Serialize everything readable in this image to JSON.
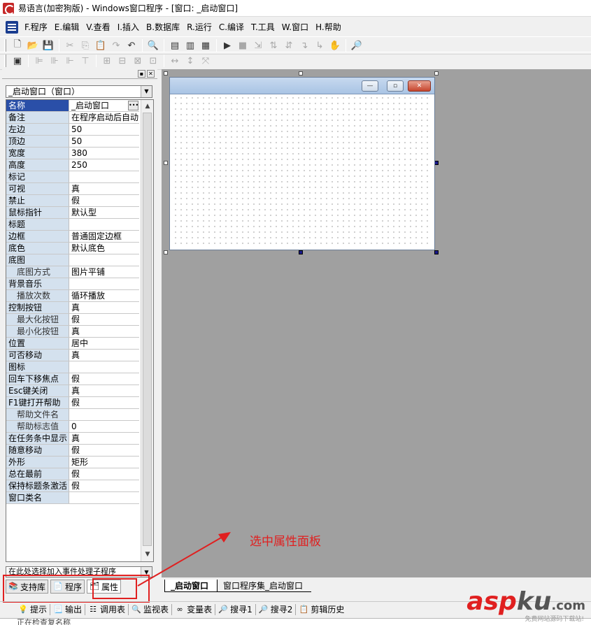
{
  "window": {
    "title": "易语言(加密狗版) - Windows窗口程序 - [窗口: _启动窗口]"
  },
  "menu": [
    "F.程序",
    "E.编辑",
    "V.查看",
    "I.插入",
    "B.数据库",
    "R.运行",
    "C.编译",
    "T.工具",
    "W.窗口",
    "H.帮助"
  ],
  "toolbar1": [
    {
      "icon": "new-file-icon",
      "glyph": "🗋"
    },
    {
      "icon": "open-folder-icon",
      "glyph": "📂"
    },
    {
      "icon": "save-icon",
      "glyph": "💾"
    },
    {
      "sep": true
    },
    {
      "icon": "cut-icon",
      "glyph": "✂",
      "dim": true
    },
    {
      "icon": "copy-icon",
      "glyph": "⎘",
      "dim": true
    },
    {
      "icon": "paste-icon",
      "glyph": "📋"
    },
    {
      "icon": "redo-icon",
      "glyph": "↷",
      "dim": true
    },
    {
      "icon": "undo-icon",
      "glyph": "↶"
    },
    {
      "sep": true
    },
    {
      "icon": "find-icon",
      "glyph": "🔍"
    },
    {
      "sep": true
    },
    {
      "icon": "layout-1-icon",
      "glyph": "▤"
    },
    {
      "icon": "layout-2-icon",
      "glyph": "▥"
    },
    {
      "icon": "layout-3-icon",
      "glyph": "▦"
    },
    {
      "sep": true
    },
    {
      "icon": "run-icon",
      "glyph": "▶"
    },
    {
      "icon": "stop-icon",
      "glyph": "■",
      "dim": true
    },
    {
      "icon": "step-1-icon",
      "glyph": "⇲",
      "dim": true
    },
    {
      "icon": "step-2-icon",
      "glyph": "⇅",
      "dim": true
    },
    {
      "icon": "step-3-icon",
      "glyph": "⇵",
      "dim": true
    },
    {
      "icon": "step-4-icon",
      "glyph": "↴",
      "dim": true
    },
    {
      "icon": "step-5-icon",
      "glyph": "↳",
      "dim": true
    },
    {
      "icon": "hand-icon",
      "glyph": "✋",
      "dim": true
    },
    {
      "sep": true
    },
    {
      "icon": "help-search-icon",
      "glyph": "🔎"
    }
  ],
  "toolbar2": [
    {
      "icon": "form-icon",
      "glyph": "▣"
    },
    {
      "sep": true
    },
    {
      "icon": "align-left-icon",
      "glyph": "⊫",
      "dim": true
    },
    {
      "icon": "align-center-icon",
      "glyph": "⊪",
      "dim": true
    },
    {
      "icon": "align-right-icon",
      "glyph": "⊩",
      "dim": true
    },
    {
      "icon": "align-top-icon",
      "glyph": "⊤",
      "dim": true
    },
    {
      "sep": true
    },
    {
      "icon": "center-h-icon",
      "glyph": "⊞",
      "dim": true
    },
    {
      "icon": "center-v-icon",
      "glyph": "⊟",
      "dim": true
    },
    {
      "icon": "space-h-icon",
      "glyph": "⊠",
      "dim": true
    },
    {
      "icon": "space-v-icon",
      "glyph": "⊡",
      "dim": true
    },
    {
      "sep": true
    },
    {
      "icon": "size-w-icon",
      "glyph": "↔",
      "dim": true
    },
    {
      "icon": "size-h-icon",
      "glyph": "↕",
      "dim": true
    },
    {
      "icon": "size-both-icon",
      "glyph": "⤧",
      "dim": true
    }
  ],
  "object_selector": "_启动窗口（窗口）",
  "properties": [
    {
      "name": "名称",
      "value": "_启动窗口",
      "selected": true,
      "ellipsis": true
    },
    {
      "name": "备注",
      "value": "在程序启动后自动"
    },
    {
      "name": "左边",
      "value": "50"
    },
    {
      "name": "顶边",
      "value": "50"
    },
    {
      "name": "宽度",
      "value": "380"
    },
    {
      "name": "高度",
      "value": "250"
    },
    {
      "name": "标记",
      "value": ""
    },
    {
      "name": "可视",
      "value": "真"
    },
    {
      "name": "禁止",
      "value": "假"
    },
    {
      "name": "鼠标指针",
      "value": "默认型"
    },
    {
      "name": "标题",
      "value": ""
    },
    {
      "name": "边框",
      "value": "普通固定边框"
    },
    {
      "name": "底色",
      "value": "默认底色"
    },
    {
      "name": "底图",
      "value": ""
    },
    {
      "name": "底图方式",
      "value": "图片平铺",
      "sub": true
    },
    {
      "name": "背景音乐",
      "value": ""
    },
    {
      "name": "播放次数",
      "value": "循环播放",
      "sub": true
    },
    {
      "name": "控制按钮",
      "value": "真"
    },
    {
      "name": "最大化按钮",
      "value": "假",
      "sub": true
    },
    {
      "name": "最小化按钮",
      "value": "真",
      "sub": true
    },
    {
      "name": "位置",
      "value": "居中"
    },
    {
      "name": "可否移动",
      "value": "真"
    },
    {
      "name": "图标",
      "value": ""
    },
    {
      "name": "回车下移焦点",
      "value": "假"
    },
    {
      "name": "Esc键关闭",
      "value": "真"
    },
    {
      "name": "F1键打开帮助",
      "value": "假"
    },
    {
      "name": "帮助文件名",
      "value": "",
      "sub": true
    },
    {
      "name": "帮助标志值",
      "value": "0",
      "sub": true
    },
    {
      "name": "在任务条中显示",
      "value": "真"
    },
    {
      "name": "随意移动",
      "value": "假"
    },
    {
      "name": "外形",
      "value": "矩形"
    },
    {
      "name": "总在最前",
      "value": "假"
    },
    {
      "name": "保持标题条激活",
      "value": "假"
    },
    {
      "name": "窗口类名",
      "value": ""
    }
  ],
  "event_selector": "在此处选择加入事件处理子程序",
  "panel_tabs": [
    {
      "label": "支持库",
      "icon": "library-icon",
      "glyph": "📚"
    },
    {
      "label": "程序",
      "icon": "program-icon",
      "glyph": "📄"
    },
    {
      "label": "属性",
      "icon": "properties-icon",
      "glyph": "🗂",
      "active": true
    }
  ],
  "annotation": "选中属性面板",
  "doc_tabs": [
    {
      "label": "_启动窗口",
      "active": true
    },
    {
      "label": "窗口程序集_启动窗口"
    }
  ],
  "output_tabs": [
    {
      "label": "提示",
      "icon": "tip-icon",
      "glyph": "💡"
    },
    {
      "label": "输出",
      "icon": "output-icon",
      "glyph": "📃"
    },
    {
      "label": "调用表",
      "icon": "callstack-icon",
      "glyph": "☷"
    },
    {
      "label": "监视表",
      "icon": "watch-icon",
      "glyph": "🔍"
    },
    {
      "label": "变量表",
      "icon": "variables-icon",
      "glyph": "∞"
    },
    {
      "label": "搜寻1",
      "icon": "search1-icon",
      "glyph": "🔎"
    },
    {
      "label": "搜寻2",
      "icon": "search2-icon",
      "glyph": "🔎"
    },
    {
      "label": "剪辑历史",
      "icon": "clip-history-icon",
      "glyph": "📋"
    }
  ],
  "status_text": "正在检查复名称",
  "watermark": {
    "part1": "asp",
    "part2": "ku",
    "part3": ".com",
    "sub": "免费网站源码下载站!"
  }
}
